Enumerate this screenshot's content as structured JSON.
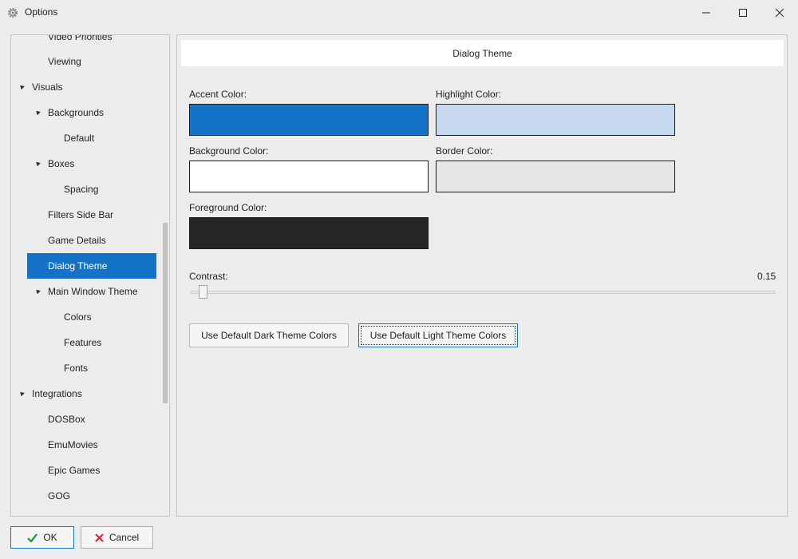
{
  "window": {
    "title": "Options",
    "icon": "gear-icon"
  },
  "sidebar": {
    "items": [
      {
        "label": "Video Priorities",
        "level": 1,
        "expandable": false
      },
      {
        "label": "Viewing",
        "level": 1,
        "expandable": false
      },
      {
        "label": "Visuals",
        "level": 0,
        "expandable": true
      },
      {
        "label": "Backgrounds",
        "level": 1,
        "expandable": true
      },
      {
        "label": "Default",
        "level": 2,
        "expandable": false
      },
      {
        "label": "Boxes",
        "level": 1,
        "expandable": true
      },
      {
        "label": "Spacing",
        "level": 2,
        "expandable": false
      },
      {
        "label": "Filters Side Bar",
        "level": 1,
        "expandable": false
      },
      {
        "label": "Game Details",
        "level": 1,
        "expandable": false
      },
      {
        "label": "Dialog Theme",
        "level": 1,
        "expandable": false,
        "selected": true
      },
      {
        "label": "Main Window Theme",
        "level": 1,
        "expandable": true
      },
      {
        "label": "Colors",
        "level": 2,
        "expandable": false
      },
      {
        "label": "Features",
        "level": 2,
        "expandable": false
      },
      {
        "label": "Fonts",
        "level": 2,
        "expandable": false
      },
      {
        "label": "Integrations",
        "level": 0,
        "expandable": true
      },
      {
        "label": "DOSBox",
        "level": 1,
        "expandable": false
      },
      {
        "label": "EmuMovies",
        "level": 1,
        "expandable": false
      },
      {
        "label": "Epic Games",
        "level": 1,
        "expandable": false
      },
      {
        "label": "GOG",
        "level": 1,
        "expandable": false
      }
    ]
  },
  "panel": {
    "header": "Dialog Theme",
    "colors": {
      "accent": {
        "label": "Accent Color:",
        "value": "#1473C6"
      },
      "highlight": {
        "label": "Highlight Color:",
        "value": "#C6D8EE"
      },
      "background": {
        "label": "Background Color:",
        "value": "#FFFFFF"
      },
      "border": {
        "label": "Border Color:",
        "value": "#E6E6E6"
      },
      "foreground": {
        "label": "Foreground Color:",
        "value": "#252525"
      }
    },
    "contrast": {
      "label": "Contrast:",
      "value_text": "0.15",
      "value": 0.15
    },
    "buttons": {
      "dark": "Use Default Dark Theme Colors",
      "light": "Use Default Light Theme Colors"
    }
  },
  "footer": {
    "ok": "OK",
    "cancel": "Cancel"
  },
  "theme": {
    "accent": "#1473C6",
    "ok_icon_color": "#2e9a3a",
    "cancel_icon_color": "#d0312d"
  }
}
